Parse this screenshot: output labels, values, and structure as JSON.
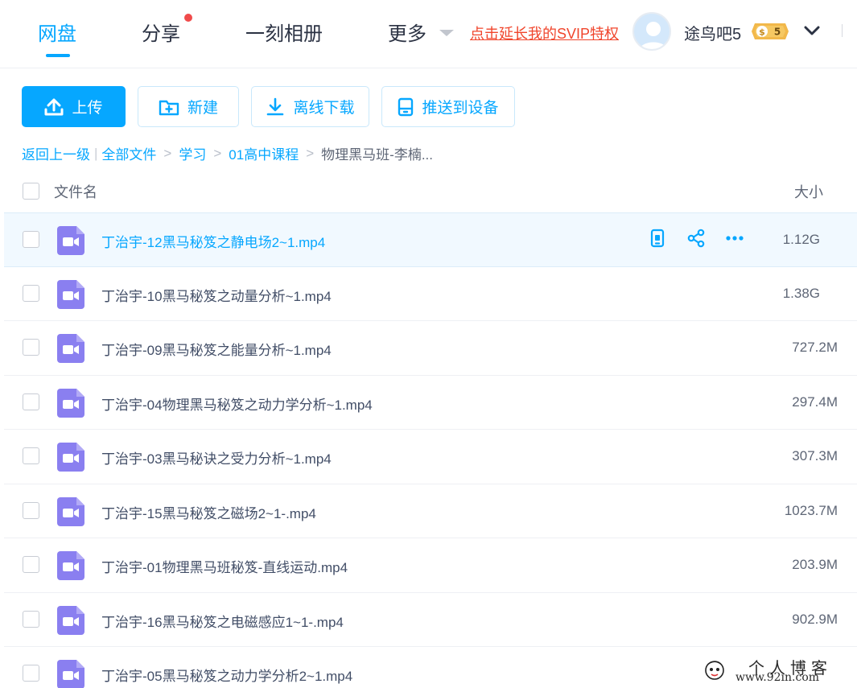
{
  "nav": {
    "tabs": [
      {
        "label": "网盘",
        "active": true
      },
      {
        "label": "分享",
        "has_notification": true
      },
      {
        "label": "一刻相册"
      },
      {
        "label": "更多"
      }
    ],
    "svip_link": "点击延长我的SVIP特权",
    "username": "途鸟吧5",
    "vip_level": "5"
  },
  "toolbar": {
    "upload_label": "上传",
    "new_label": "新建",
    "offline_download_label": "离线下载",
    "push_to_device_label": "推送到设备"
  },
  "breadcrumb": {
    "back": "返回上一级",
    "separator_bar": "|",
    "all_files": "全部文件",
    "separator": ">",
    "items": [
      "学习",
      "01高中课程"
    ],
    "current": "物理黑马班-李楠..."
  },
  "list": {
    "columns": {
      "name": "文件名",
      "size": "大小"
    },
    "rows": [
      {
        "name": "丁治宇-12黑马秘笈之静电场2~1.mp4",
        "size": "1.12G",
        "hovered": true
      },
      {
        "name": "丁治宇-10黑马秘笈之动量分析~1.mp4",
        "size": "1.38G"
      },
      {
        "name": "丁治宇-09黑马秘笈之能量分析~1.mp4",
        "size": "727.2M"
      },
      {
        "name": "丁治宇-04物理黑马秘笈之动力学分析~1.mp4",
        "size": "297.4M"
      },
      {
        "name": "丁治宇-03黑马秘诀之受力分析~1.mp4",
        "size": "307.3M"
      },
      {
        "name": "丁治宇-15黑马秘笈之磁场2~1-.mp4",
        "size": "1023.7M"
      },
      {
        "name": "丁治宇-01物理黑马班秘笈-直线运动.mp4",
        "size": "203.9M"
      },
      {
        "name": "丁治宇-16黑马秘笈之电磁感应1~1-.mp4",
        "size": "902.9M"
      },
      {
        "name": "丁治宇-05黑马秘笈之动力学分析2~1.mp4",
        "size": ""
      }
    ]
  },
  "watermark": {
    "title": "个人博客",
    "url": "www.92in.com"
  },
  "colors": {
    "accent": "#06a7ff",
    "svip_red": "#f0452c",
    "video_icon": "#8a7ff0",
    "hover_row": "#f1f9ff"
  },
  "icons": [
    "upload-icon",
    "new-folder-icon",
    "download-icon",
    "push-device-icon",
    "video-file-icon",
    "phone-icon",
    "share-icon",
    "more-icon",
    "chevron-down-icon"
  ]
}
